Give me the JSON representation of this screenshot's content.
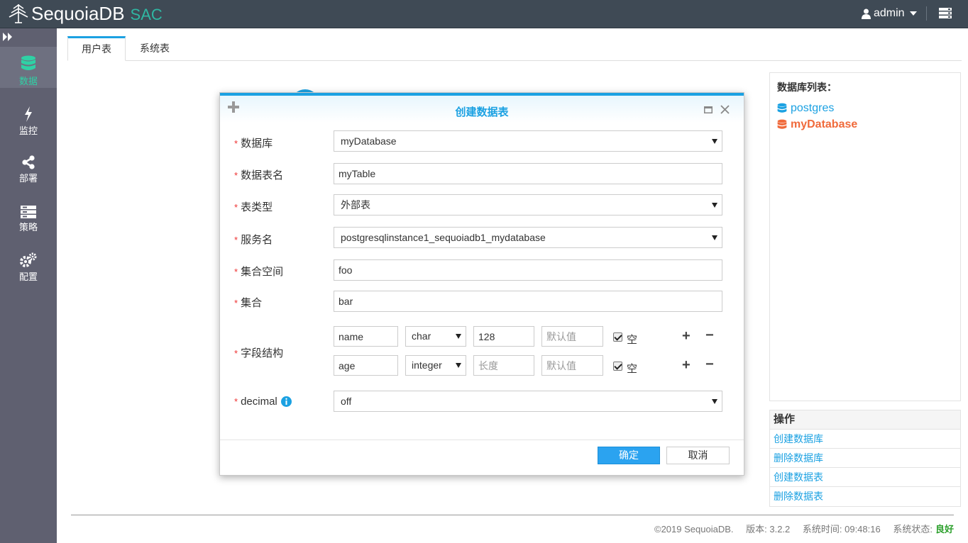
{
  "app": {
    "logo_text": "SequoiaDB",
    "logo_suffix": "SAC"
  },
  "topbar": {
    "user": "admin"
  },
  "sidebar": {
    "items": [
      {
        "label": "数据",
        "icon": "database-icon",
        "active": true
      },
      {
        "label": "监控",
        "icon": "bolt-icon"
      },
      {
        "label": "部署",
        "icon": "share-icon"
      },
      {
        "label": "策略",
        "icon": "list-icon"
      },
      {
        "label": "配置",
        "icon": "gears-icon"
      }
    ]
  },
  "tabs": [
    {
      "label": "用户表",
      "active": true
    },
    {
      "label": "系统表"
    }
  ],
  "db_panel": {
    "title": "数据库列表：",
    "items": [
      {
        "name": "postgres",
        "selected": false
      },
      {
        "name": "myDatabase",
        "selected": true
      }
    ]
  },
  "operations": {
    "title": "操作",
    "items": [
      "创建数据库",
      "删除数据库",
      "创建数据表",
      "删除数据表"
    ]
  },
  "footer": {
    "copyright": "©2019 SequoiaDB.",
    "version": "版本: 3.2.2",
    "time": "系统时间: 09:48:16",
    "status_label": "系统状态:",
    "status_value": "良好"
  },
  "modal": {
    "title": "创建数据表",
    "fields": {
      "database": {
        "label": "数据库",
        "value": "myDatabase"
      },
      "table_name": {
        "label": "数据表名",
        "value": "myTable"
      },
      "table_type": {
        "label": "表类型",
        "value": "外部表"
      },
      "service": {
        "label": "服务名",
        "value": "postgresqlinstance1_sequoiadb1_mydatabase"
      },
      "collection_space": {
        "label": "集合空间",
        "value": "foo"
      },
      "collection": {
        "label": "集合",
        "value": "bar"
      },
      "structure": {
        "label": "字段结构",
        "rows": [
          {
            "name": "name",
            "type": "char",
            "length": "128",
            "length_placeholder": "长度",
            "default_placeholder": "默认值",
            "null_label": "空",
            "null_checked": true
          },
          {
            "name": "age",
            "type": "integer",
            "length": "",
            "length_placeholder": "长度",
            "default_placeholder": "默认值",
            "null_label": "空",
            "null_checked": true
          }
        ],
        "add_symbol": "+",
        "remove_symbol": "−"
      },
      "decimal": {
        "label": "decimal",
        "value": "off"
      }
    },
    "ok_label": "确定",
    "cancel_label": "取消",
    "required_mark": "*"
  },
  "colors": {
    "accent": "#1ba1e2",
    "sidebar": "#5f6070",
    "topbar": "#3f4a55",
    "active_green": "#2fd1a5",
    "selected_db": "#f06a3b"
  }
}
